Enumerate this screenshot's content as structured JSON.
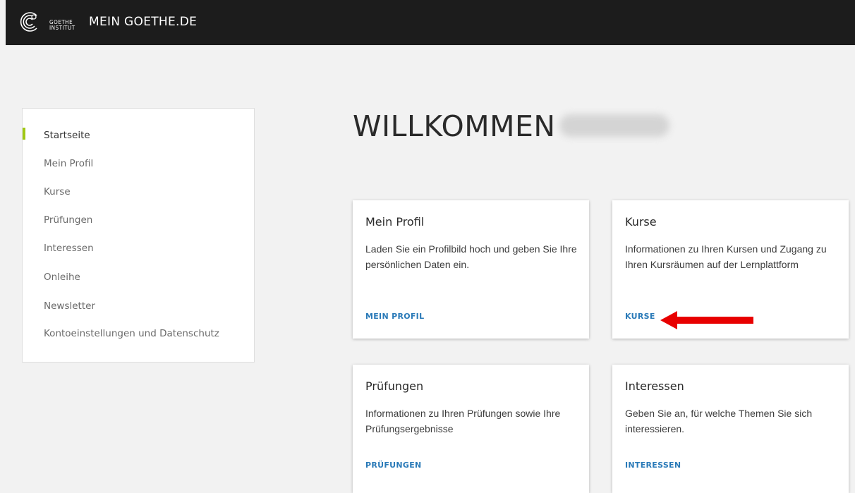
{
  "header": {
    "logo_lines": [
      "GOETHE",
      "INSTITUT"
    ],
    "site_title": "MEIN GOETHE.DE"
  },
  "sidebar": {
    "items": [
      {
        "label": "Startseite",
        "active": true
      },
      {
        "label": "Mein Profil"
      },
      {
        "label": "Kurse"
      },
      {
        "label": "Prüfungen"
      },
      {
        "label": "Interessen"
      },
      {
        "label": "Onleihe"
      },
      {
        "label": "Newsletter"
      },
      {
        "label": "Kontoeinstellungen und Datenschutz"
      }
    ],
    "active_color": "#a0c814"
  },
  "main": {
    "welcome": "WILLKOMMEN",
    "cards": [
      {
        "title": "Mein Profil",
        "text": "Laden Sie ein Profilbild hoch und geben Sie Ihre persönlichen Daten ein.",
        "link": "MEIN PROFIL"
      },
      {
        "title": "Kurse",
        "text": "Informationen zu Ihren Kursen und Zugang zu Ihren Kursräumen auf der Lernplattform",
        "link": "KURSE"
      },
      {
        "title": "Prüfungen",
        "text": "Informationen zu Ihren Prüfungen sowie Ihre Prüfungsergebnisse",
        "link": "PRÜFUNGEN"
      },
      {
        "title": "Interessen",
        "text": "Geben Sie an, für welche Themen Sie sich interessieren.",
        "link": "INTERESSEN"
      }
    ]
  },
  "colors": {
    "link": "#2a7ab8",
    "header_bg": "#1c1c1c",
    "annotation_arrow": "#e80000"
  }
}
